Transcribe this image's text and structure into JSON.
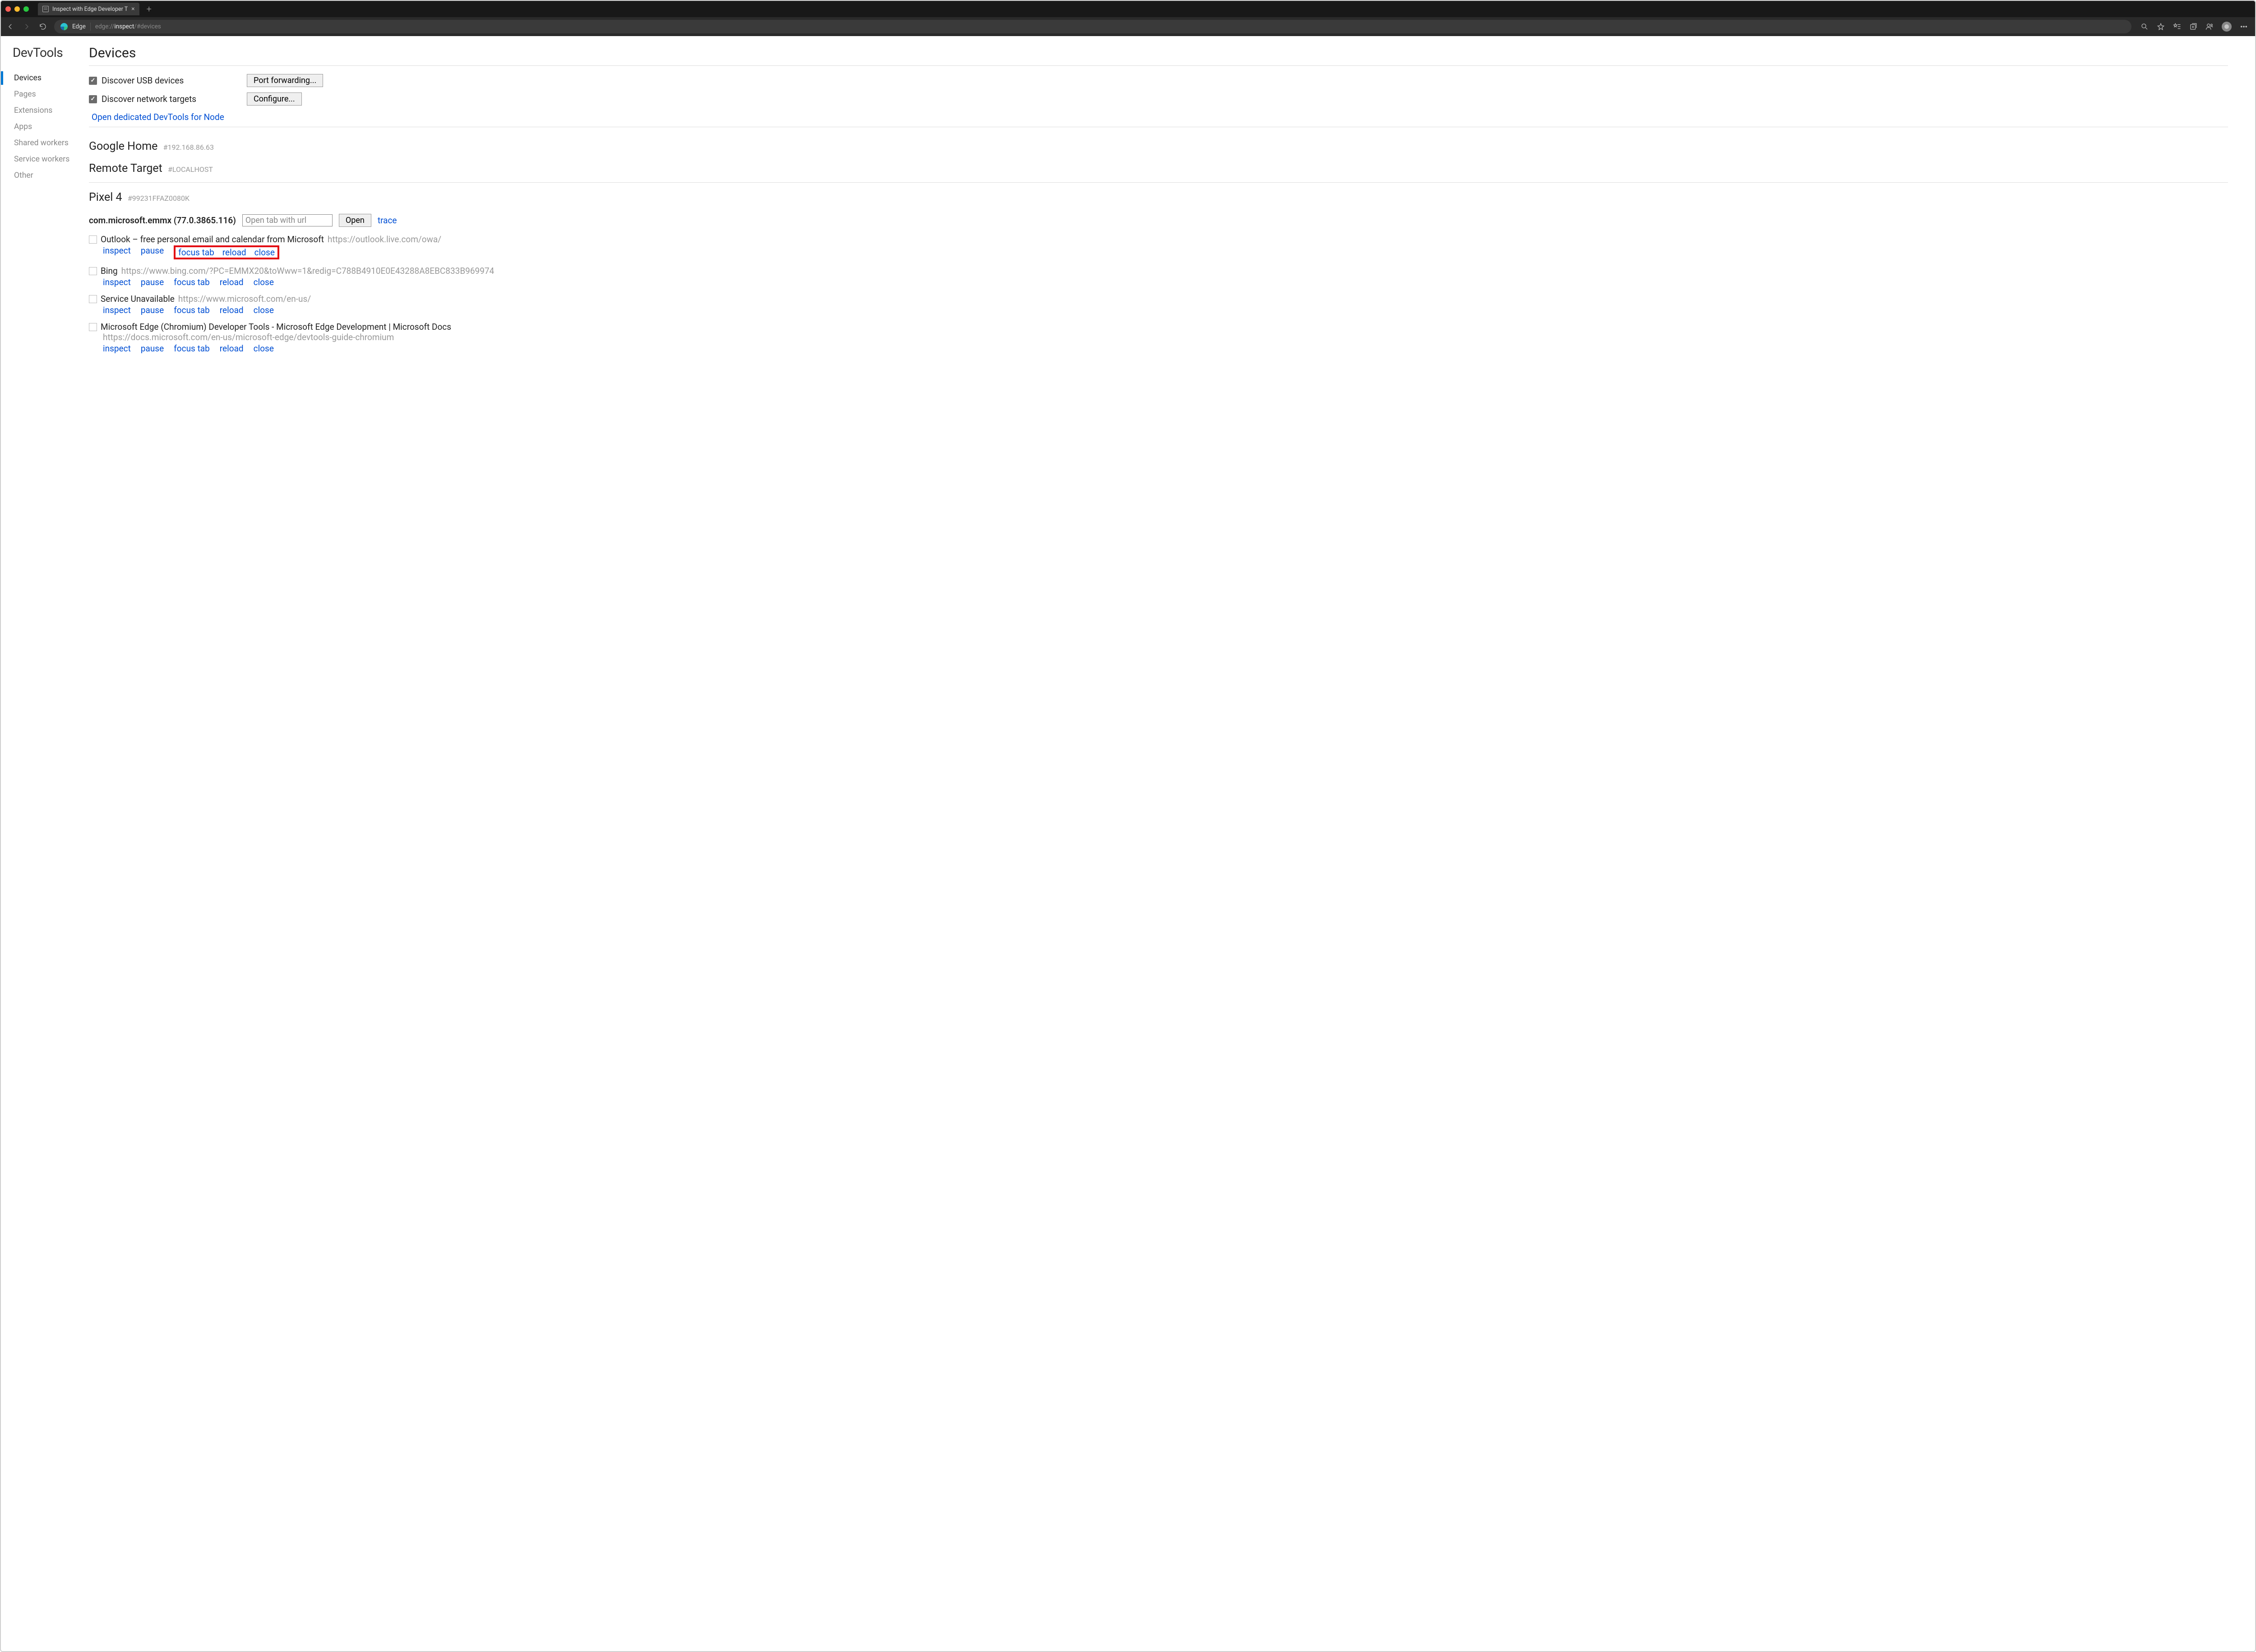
{
  "window": {
    "tab_title": "Inspect with Edge Developer T",
    "addr_host": "Edge",
    "url_dim1": "edge://",
    "url_bright": "inspect",
    "url_dim2": "/#devices"
  },
  "sidebar": {
    "title": "DevTools",
    "items": [
      {
        "label": "Devices",
        "active": true
      },
      {
        "label": "Pages",
        "active": false
      },
      {
        "label": "Extensions",
        "active": false
      },
      {
        "label": "Apps",
        "active": false
      },
      {
        "label": "Shared workers",
        "active": false
      },
      {
        "label": "Service workers",
        "active": false
      },
      {
        "label": "Other",
        "active": false
      }
    ]
  },
  "page": {
    "title": "Devices",
    "discover_usb": "Discover USB devices",
    "port_fwd_btn": "Port forwarding...",
    "discover_net": "Discover network targets",
    "configure_btn": "Configure...",
    "node_link": "Open dedicated DevTools for Node",
    "device1_name": "Google Home",
    "device1_hash": "#192.168.86.63",
    "device2_name": "Remote Target",
    "device2_hash": "#LOCALHOST",
    "device3_name": "Pixel 4",
    "device3_hash": "#99231FFAZ0080K",
    "target_name": "com.microsoft.emmx (77.0.3865.116)",
    "open_placeholder": "Open tab with url",
    "open_btn": "Open",
    "trace": "trace",
    "actions": {
      "inspect": "inspect",
      "pause": "pause",
      "focus": "focus tab",
      "reload": "reload",
      "close": "close"
    },
    "pages": [
      {
        "title": "Outlook – free personal email and calendar from Microsoft",
        "url": "https://outlook.live.com/owa/",
        "highlight": true,
        "stack": false
      },
      {
        "title": "Bing",
        "url": "https://www.bing.com/?PC=EMMX20&toWww=1&redig=C788B4910E0E43288A8EBC833B969974",
        "highlight": false,
        "stack": false
      },
      {
        "title": "Service Unavailable",
        "url": "https://www.microsoft.com/en-us/",
        "highlight": false,
        "stack": false
      },
      {
        "title": "Microsoft Edge (Chromium) Developer Tools - Microsoft Edge Development | Microsoft Docs",
        "url": "https://docs.microsoft.com/en-us/microsoft-edge/devtools-guide-chromium",
        "highlight": false,
        "stack": true
      }
    ]
  }
}
